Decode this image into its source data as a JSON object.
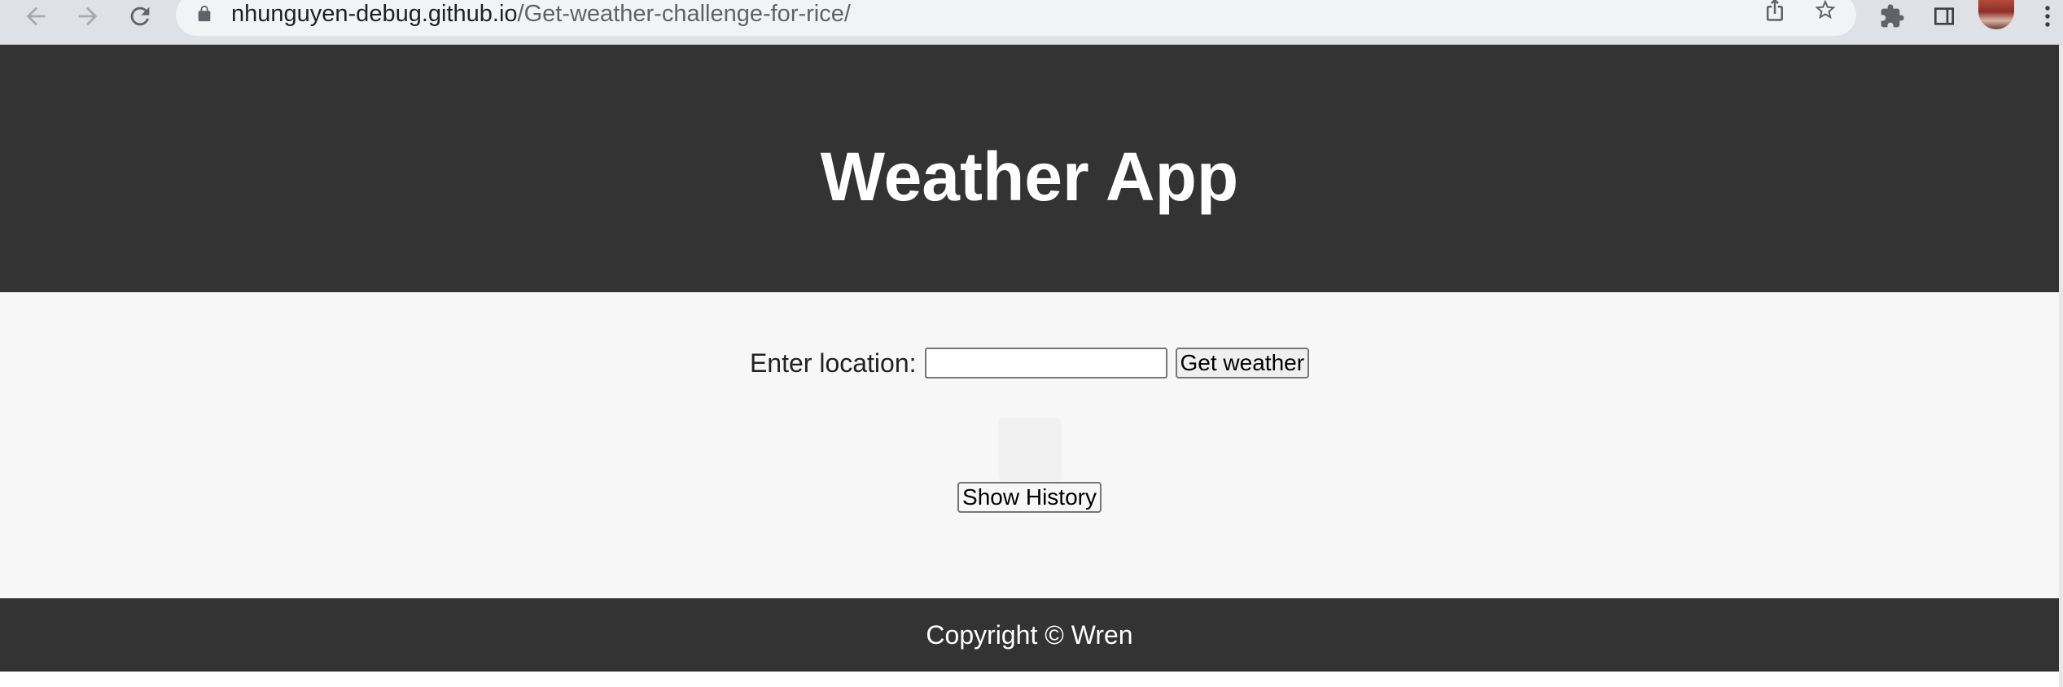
{
  "browser": {
    "url_host": "nhunguyen-debug.github.io",
    "url_path": "/Get-weather-challenge-for-rice/",
    "icons": {
      "back": "arrow-left-icon",
      "forward": "arrow-right-icon",
      "reload": "reload-icon",
      "lock": "lock-icon",
      "share": "share-icon",
      "bookmark": "star-icon",
      "extensions": "puzzle-icon",
      "side_panel": "side-panel-icon",
      "menu": "kebab-menu-icon"
    }
  },
  "header": {
    "title": "Weather App",
    "background": "#333333"
  },
  "form": {
    "label": "Enter location:",
    "input_value": "",
    "submit_label": "Get weather"
  },
  "history": {
    "button_label": "Show History"
  },
  "footer": {
    "text": "Copyright © Wren",
    "background": "#333333"
  },
  "colors": {
    "body_background": "#f7f7f7",
    "chrome_background": "#dee1e6",
    "header_text": "#ffffff"
  }
}
